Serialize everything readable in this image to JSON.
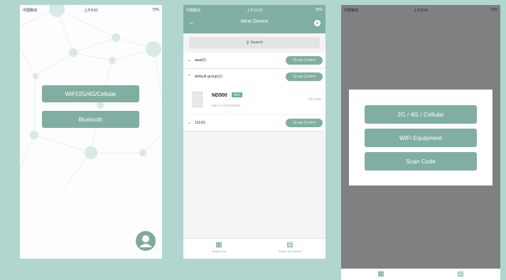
{
  "screen1": {
    "status": {
      "carrier": "中国移动",
      "time": "上午9:52",
      "battery": "72%"
    },
    "buttons": {
      "wifi": "WIFI/2G/4G/Cellular",
      "bluetooth": "Bluetooth"
    },
    "icons": {
      "avatar": "user-avatar-icon",
      "background": "network-nodes"
    }
  },
  "screen2": {
    "status": {
      "carrier": "中国移动",
      "time": "上午11:03",
      "battery": "55%"
    },
    "title": "Mine Device",
    "search_placeholder": "Search",
    "groups": [
      {
        "name": "aaa(0)",
        "control": "Group Control"
      },
      {
        "name": "default group(1)",
        "control": "Group Control"
      },
      {
        "name": "111(0)",
        "control": "Group Control"
      }
    ],
    "device": {
      "name": "ND500",
      "tag": "WiFi",
      "mac": "Mac:AC3GF430860",
      "status": "On-Line"
    },
    "tabs": {
      "device_list": "Device List",
      "select_device": "Select The Device"
    }
  },
  "screen3": {
    "status": {
      "carrier": "中国移动",
      "time": "上午9:54",
      "battery": "72%"
    },
    "options": {
      "cellular": "2G / 4G / Cellular",
      "wifi": "WiFi Equipment",
      "scan": "Scan Code"
    }
  },
  "colors": {
    "accent": "#80aea2",
    "background": "#b0d6cf",
    "overlay": "#808080"
  }
}
